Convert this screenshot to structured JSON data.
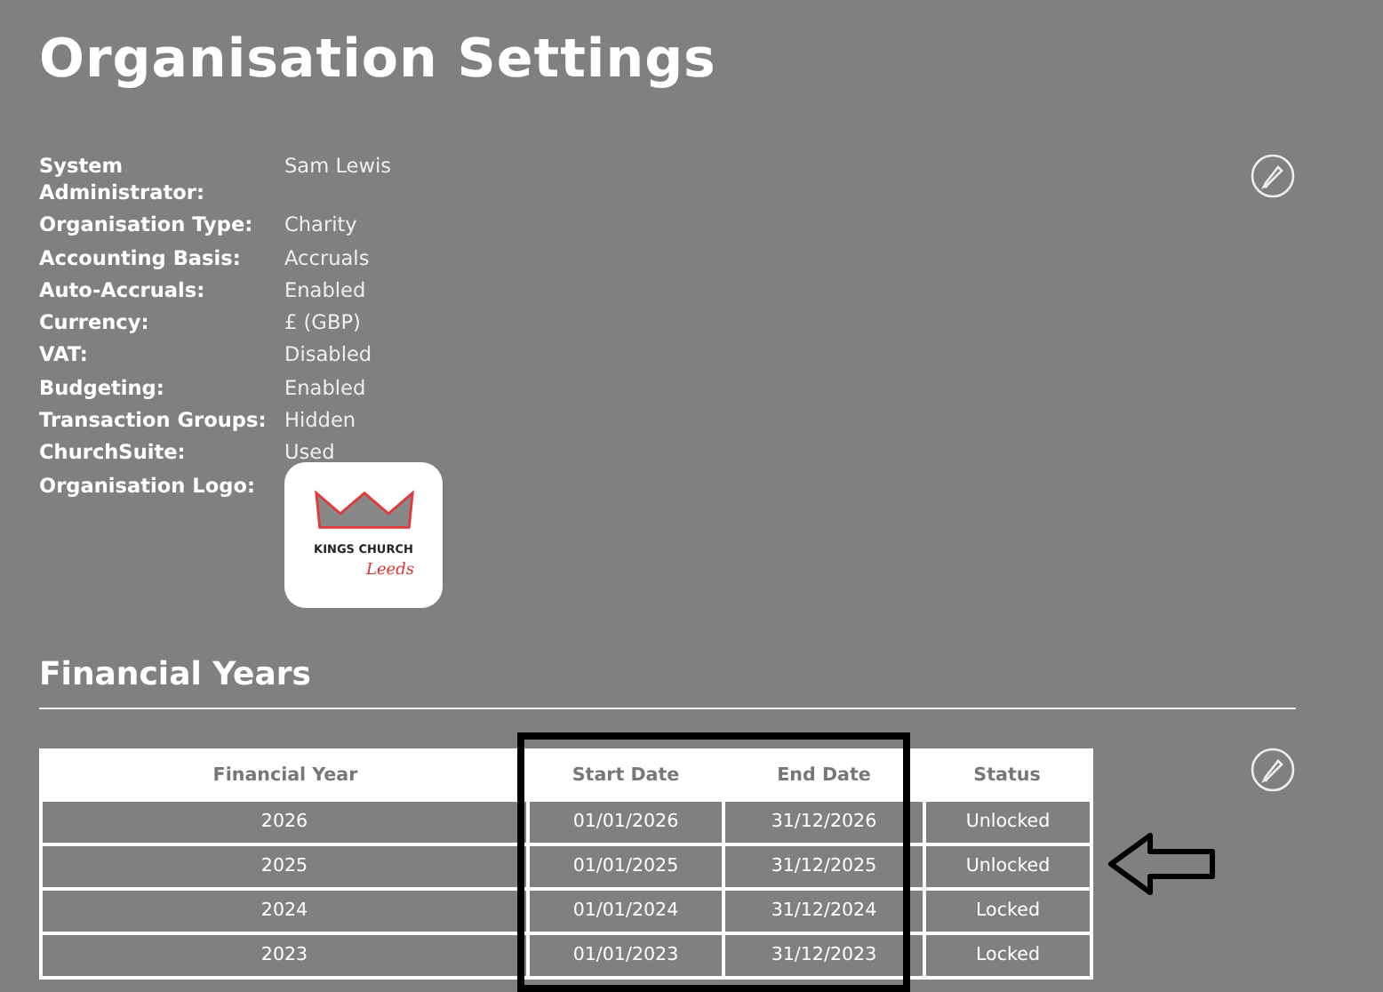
{
  "title": "Organisation Settings",
  "settings": [
    {
      "label": "System Administrator:",
      "value": "Sam Lewis"
    },
    {
      "label": "Organisation Type:",
      "value": "Charity"
    },
    {
      "label": "Accounting Basis:",
      "value": "Accruals"
    },
    {
      "label": "Auto-Accruals:",
      "value": "Enabled"
    },
    {
      "label": "Currency:",
      "value": "£ (GBP)"
    },
    {
      "label": "VAT:",
      "value": "Disabled"
    },
    {
      "label": "Budgeting:",
      "value": "Enabled"
    },
    {
      "label": "Transaction Groups:",
      "value": "Hidden"
    },
    {
      "label": "ChurchSuite:",
      "value": "Used"
    }
  ],
  "logo": {
    "label": "Organisation Logo:",
    "name": "KINGS CHURCH",
    "script": "Leeds"
  },
  "financial_years": {
    "heading": "Financial Years",
    "columns": [
      "Financial Year",
      "Start Date",
      "End Date",
      "Status"
    ],
    "rows": [
      [
        "2026",
        "01/01/2026",
        "31/12/2026",
        "Unlocked"
      ],
      [
        "2025",
        "01/01/2025",
        "31/12/2025",
        "Unlocked"
      ],
      [
        "2024",
        "01/01/2024",
        "31/12/2024",
        "Locked"
      ],
      [
        "2023",
        "01/01/2023",
        "31/12/2023",
        "Locked"
      ]
    ]
  }
}
